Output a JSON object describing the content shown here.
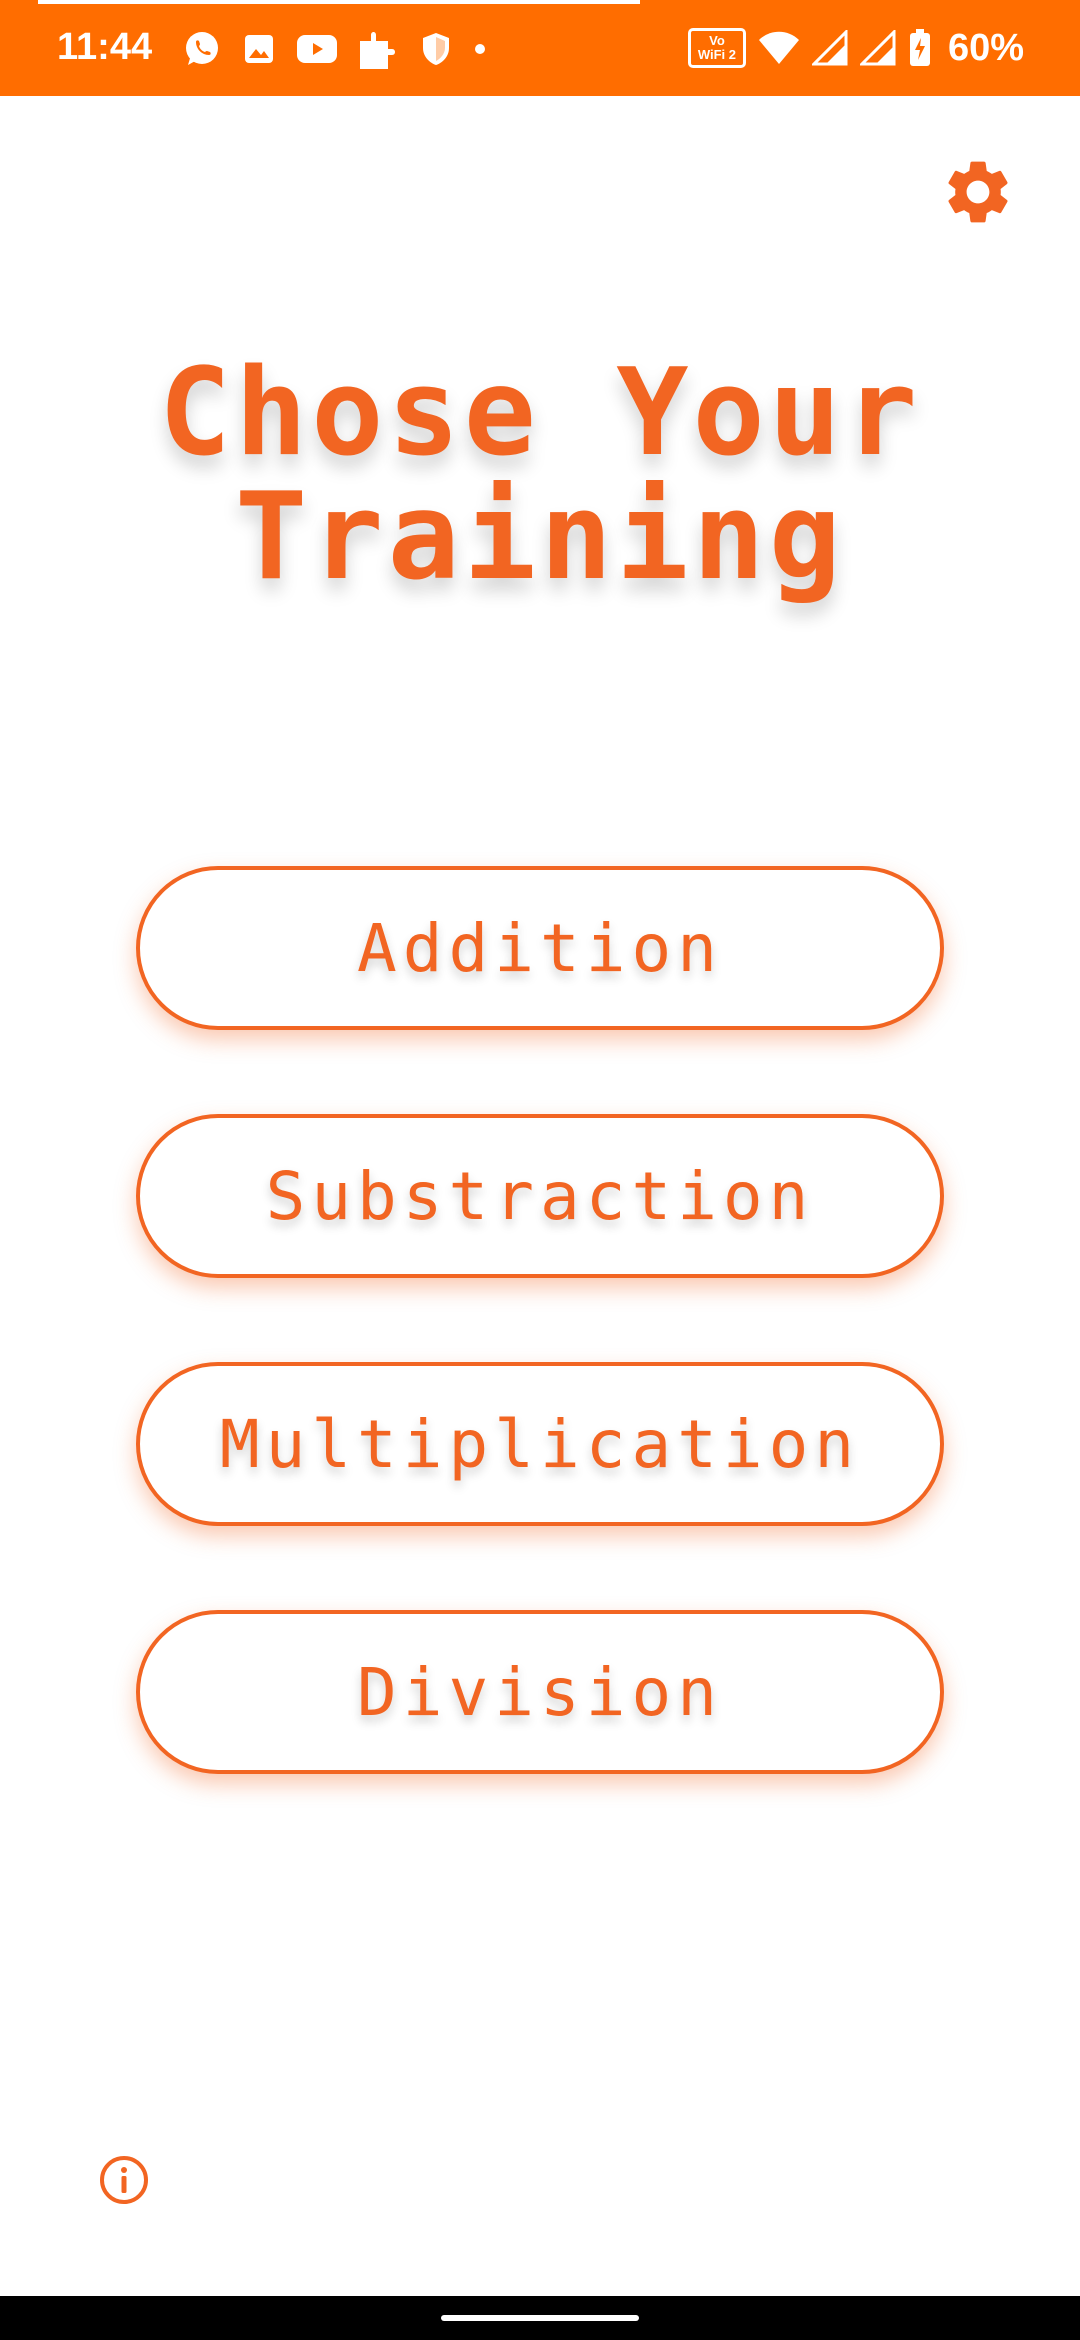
{
  "status_bar": {
    "time": "11:44",
    "battery_percent": "60%",
    "vowifi_line1": "Vo",
    "vowifi_line2": "WiFi 2",
    "icons_left": [
      "whatsapp-icon",
      "gallery-icon",
      "youtube-icon",
      "extension-icon",
      "shield-icon",
      "dot-icon"
    ],
    "icons_right": [
      "vowifi-icon",
      "wifi-icon",
      "signal-icon",
      "signal-icon",
      "battery-charging-icon"
    ]
  },
  "header": {
    "title": "Chose Your Training"
  },
  "trainings": [
    {
      "label": "Addition"
    },
    {
      "label": "Substraction"
    },
    {
      "label": "Multiplication"
    },
    {
      "label": "Division"
    }
  ],
  "colors": {
    "status_bar": "#ff6d00",
    "accent": "#f26522",
    "background": "#ffffff",
    "nav_bar": "#000000"
  },
  "icons": {
    "settings": "gear-icon",
    "info": "info-icon"
  }
}
